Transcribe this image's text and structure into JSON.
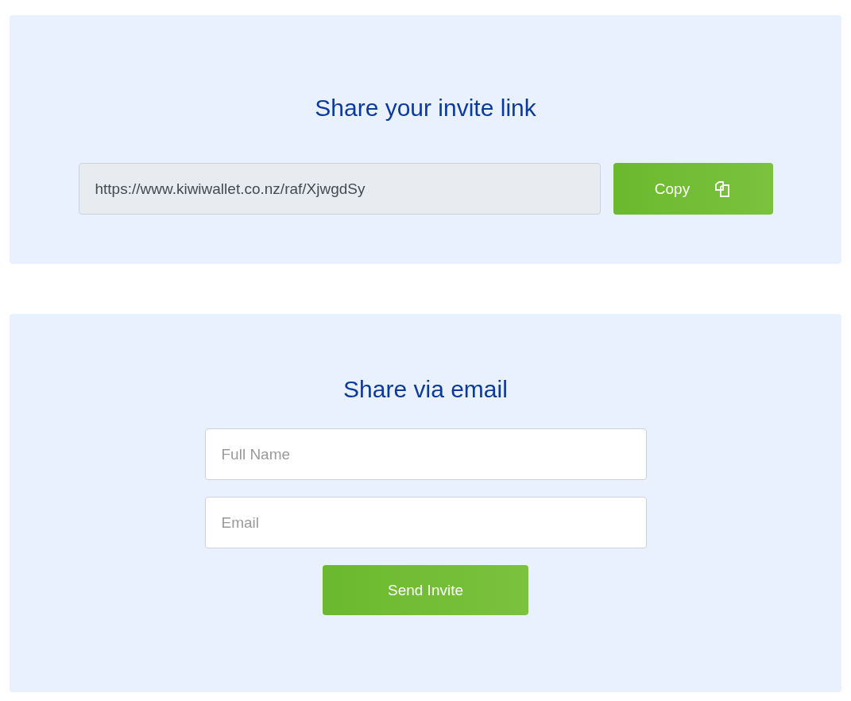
{
  "invite_link": {
    "title": "Share your invite link",
    "link": {
      "value": "https://www.kiwiwallet.co.nz/raf/XjwgdSy"
    },
    "copy_button": {
      "label": "Copy"
    }
  },
  "email_share": {
    "title": "Share via email",
    "fields": [
      {
        "placeholder": "Full Name"
      },
      {
        "placeholder": "Email"
      }
    ],
    "send_button": {
      "label": "Send Invite"
    }
  }
}
